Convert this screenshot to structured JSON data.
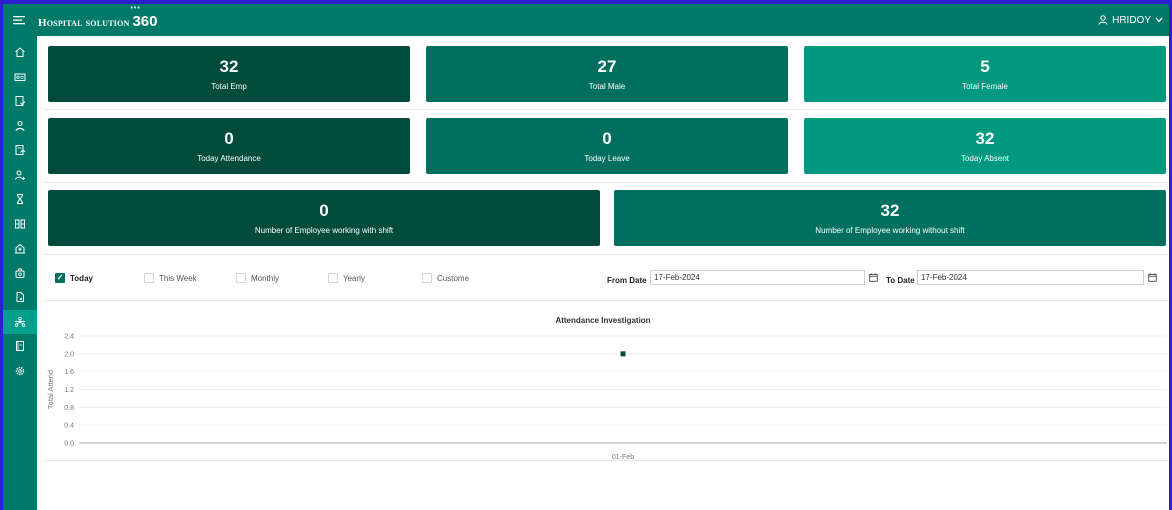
{
  "header": {
    "brand_name": "Hospital solution",
    "brand_number": "360",
    "user_name": "HRIDOY"
  },
  "sidebar": {
    "icons": [
      "home-icon",
      "id-card-icon",
      "report-icon",
      "doctor-icon",
      "receipt-icon",
      "add-user-icon",
      "hourglass-icon",
      "grid-icon",
      "hospital-icon",
      "lab-icon",
      "document-icon",
      "network-icon",
      "book-icon",
      "settings-icon"
    ],
    "active_index": 11
  },
  "stats": {
    "total_emp": {
      "value": "32",
      "label": "Total Emp"
    },
    "total_male": {
      "value": "27",
      "label": "Total Male"
    },
    "total_female": {
      "value": "5",
      "label": "Total Female"
    },
    "today_attendance": {
      "value": "0",
      "label": "Today Attendance"
    },
    "today_leave": {
      "value": "0",
      "label": "Today Leave"
    },
    "today_absent": {
      "value": "32",
      "label": "Today Absent"
    },
    "with_shift": {
      "value": "0",
      "label": "Number of Employee working with shift"
    },
    "without_shift": {
      "value": "32",
      "label": "Number of Employee working without shift"
    }
  },
  "filters": {
    "options": [
      {
        "label": "Today",
        "checked": true
      },
      {
        "label": "This Week",
        "checked": false
      },
      {
        "label": "Monthly",
        "checked": false
      },
      {
        "label": "Yearly",
        "checked": false
      },
      {
        "label": "Custome",
        "checked": false
      }
    ],
    "from_label": "From Date",
    "from_value": "17-Feb-2024",
    "to_label": "To Date",
    "to_value": "17-Feb-2024"
  },
  "colors": {
    "topbar": "#007a68",
    "card_dark": "#004b3a",
    "card_mid": "#006f60",
    "card_light": "#009980"
  },
  "chart_data": {
    "type": "scatter",
    "title": "Attendance Investigation",
    "xlabel": "",
    "ylabel": "Total Attend",
    "categories": [
      "01-Feb"
    ],
    "series": [
      {
        "values": [
          2
        ]
      }
    ],
    "ylim": [
      0,
      2.4
    ],
    "yticks": [
      "2.4",
      "2.0",
      "1.6",
      "1.2",
      "0.8",
      "0.4",
      "0.0"
    ],
    "grid": true
  }
}
